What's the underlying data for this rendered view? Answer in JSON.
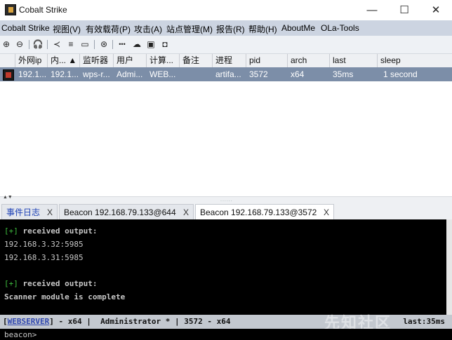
{
  "window": {
    "title": "Cobalt Strike",
    "icon": "cobalt-strike-icon",
    "controls": {
      "minimize": "—",
      "maximize": "☐",
      "close": "✕"
    }
  },
  "menu": [
    "Cobalt Strike",
    "视图(V)",
    "有效载荷(P)",
    "攻击(A)",
    "站点管理(M)",
    "报告(R)",
    "帮助(H)",
    "AboutMe",
    "OLa-Tools"
  ],
  "toolbar": [
    {
      "name": "new-connection-icon",
      "glyph": "⊕"
    },
    {
      "name": "disconnect-icon",
      "glyph": "⊖"
    },
    {
      "name": "headset-icon",
      "glyph": "🎧"
    },
    {
      "name": "share-icon",
      "glyph": "≺"
    },
    {
      "name": "list-icon",
      "glyph": "≡"
    },
    {
      "name": "targets-icon",
      "glyph": "▭"
    },
    {
      "name": "globe-icon",
      "glyph": "⊛"
    },
    {
      "name": "dots-icon",
      "glyph": "•••"
    },
    {
      "name": "cloud-icon",
      "glyph": "☁"
    },
    {
      "name": "console-icon",
      "glyph": "▣"
    },
    {
      "name": "camera-icon",
      "glyph": "◘"
    }
  ],
  "table": {
    "columns": [
      "",
      "外网ip",
      "内... ▲",
      "监听器",
      "用户",
      "计算...",
      "备注",
      "进程",
      "pid",
      "arch",
      "last",
      "sleep"
    ],
    "rows": [
      [
        "",
        "192.1...",
        "192.1...",
        "wps-r...",
        "Admi...",
        "WEB...",
        "",
        "artifa...",
        "3572",
        "x64",
        "35ms",
        "1 second"
      ]
    ]
  },
  "tabs": [
    {
      "label": "事件日志",
      "close": "X",
      "active": false,
      "color": "#1b3fb5"
    },
    {
      "label": "Beacon 192.168.79.133@644",
      "close": "X",
      "active": false
    },
    {
      "label": "Beacon 192.168.79.133@3572",
      "close": "X",
      "active": true
    }
  ],
  "console": {
    "lines": [
      {
        "prefix": "[+]",
        "text": " received output:"
      },
      {
        "prefix": "",
        "text": "192.168.3.32:5985"
      },
      {
        "prefix": "",
        "text": "192.168.3.31:5985"
      },
      {
        "prefix": "",
        "text": ""
      },
      {
        "prefix": "[+]",
        "text": " received output:"
      },
      {
        "prefix": "",
        "text": "Scanner module is complete"
      }
    ]
  },
  "status": {
    "server": "WEBSERVER",
    "rest": "] - x64 |  Administrator * | 3572 - x64",
    "open": "[",
    "last": "last:35ms"
  },
  "watermark": "先知社区",
  "input": {
    "prompt": "beacon>",
    "value": ""
  }
}
